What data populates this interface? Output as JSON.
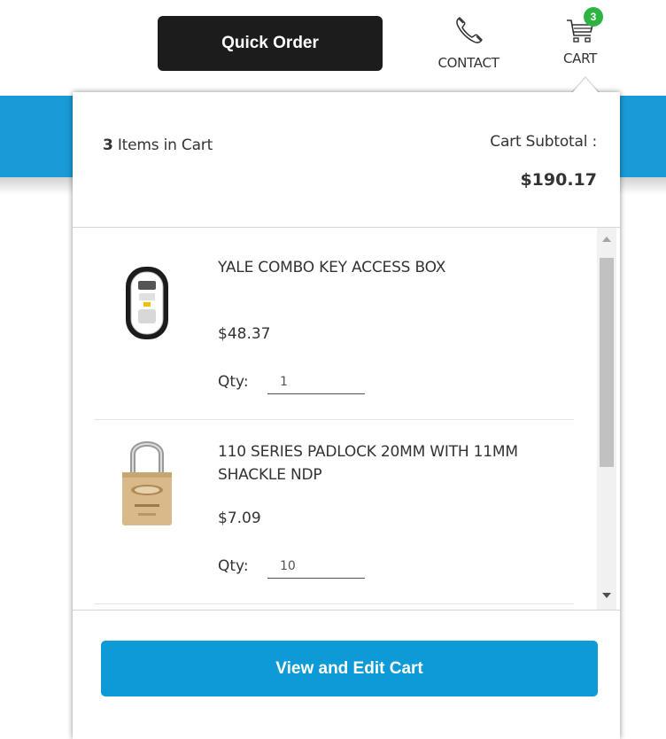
{
  "header": {
    "quick_order_label": "Quick Order",
    "contact_label": "CONTACT",
    "cart_label": "CART",
    "cart_badge_count": "3",
    "icons": {
      "contact": "phone-icon",
      "cart": "cart-icon"
    },
    "colors": {
      "badge": "#2db342",
      "quick_order_bg": "#1c1c1c"
    }
  },
  "minicart": {
    "item_count": "3",
    "items_in_cart_text": " Items in Cart",
    "subtotal_label": "Cart Subtotal :",
    "subtotal_value": "$190.17",
    "items": [
      {
        "name": "YALE COMBO KEY ACCESS BOX",
        "price": "$48.37",
        "qty_label": "Qty:",
        "qty": "1",
        "image": "key-lockbox-image"
      },
      {
        "name": "110 SERIES PADLOCK 20MM WITH 11MM SHACKLE NDP",
        "price": "$7.09",
        "qty_label": "Qty:",
        "qty": "10",
        "image": "padlock-image"
      }
    ],
    "view_cart_label": "View and Edit Cart",
    "colors": {
      "primary": "#0e9ad6"
    }
  }
}
